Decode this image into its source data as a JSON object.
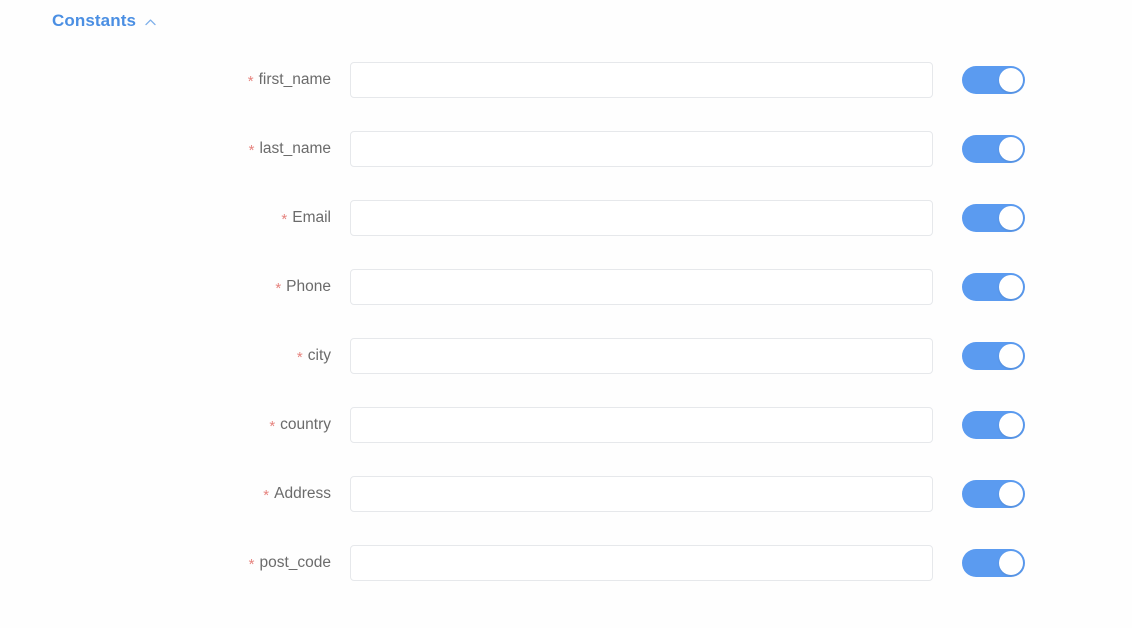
{
  "section": {
    "title": "Constants",
    "collapse_icon": "chevron-up-icon",
    "expanded": true,
    "title_color": "#4b8fe3"
  },
  "colors": {
    "accent_blue": "#4b8fe3",
    "toggle_on": "#5b9bf0",
    "required_star": "#e6837e",
    "label_text": "#6b6b6b",
    "input_border": "#e6e8eb",
    "background": "#fefefe"
  },
  "form": {
    "required_marker": "*",
    "fields": [
      {
        "label": "first_name",
        "value": "",
        "placeholder": "",
        "required": true,
        "toggle_on": true
      },
      {
        "label": "last_name",
        "value": "",
        "placeholder": "",
        "required": true,
        "toggle_on": true
      },
      {
        "label": "Email",
        "value": "",
        "placeholder": "",
        "required": true,
        "toggle_on": true
      },
      {
        "label": "Phone",
        "value": "",
        "placeholder": "",
        "required": true,
        "toggle_on": true
      },
      {
        "label": "city",
        "value": "",
        "placeholder": "",
        "required": true,
        "toggle_on": true
      },
      {
        "label": "country",
        "value": "",
        "placeholder": "",
        "required": true,
        "toggle_on": true
      },
      {
        "label": "Address",
        "value": "",
        "placeholder": "",
        "required": true,
        "toggle_on": true
      },
      {
        "label": "post_code",
        "value": "",
        "placeholder": "",
        "required": true,
        "toggle_on": true
      }
    ]
  }
}
